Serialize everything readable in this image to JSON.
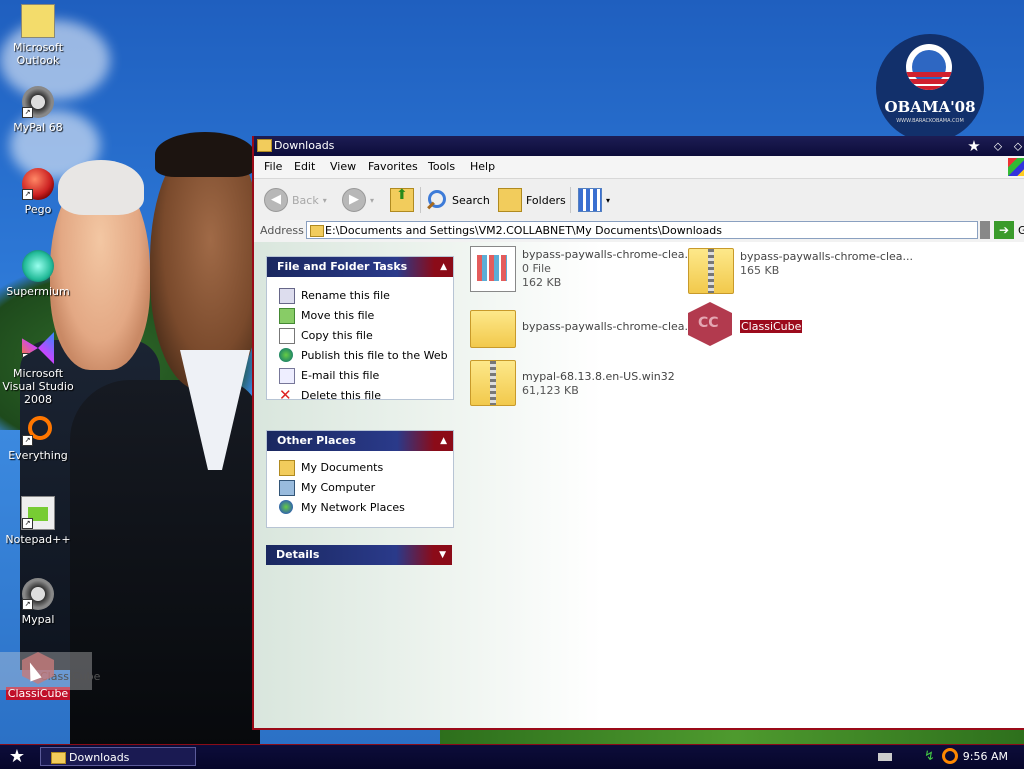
{
  "wallpaper": {
    "logo_text": "OBAMA'08",
    "logo_sub": "WWW.BARACKOBAMA.COM"
  },
  "desktop_icons": [
    {
      "label": "Microsoft Outlook",
      "icon": "outlook-icon"
    },
    {
      "label": "MyPal 68",
      "icon": "raccoon-icon"
    },
    {
      "label": "Pego",
      "icon": "pego-icon"
    },
    {
      "label": "Supermium",
      "icon": "supermium-icon"
    },
    {
      "label": "Microsoft Visual Studio 2008",
      "icon": "visual-studio-icon"
    },
    {
      "label": "Everything",
      "icon": "everything-icon"
    },
    {
      "label": "Notepad++",
      "icon": "notepadpp-icon"
    },
    {
      "label": "Mypal",
      "icon": "raccoon-icon"
    },
    {
      "label": "ClassiCube",
      "icon": "classicube-icon",
      "ghost_label": "ClassiCube"
    }
  ],
  "window": {
    "title": "Downloads",
    "menu": [
      "File",
      "Edit",
      "View",
      "Favorites",
      "Tools",
      "Help"
    ],
    "toolbar": {
      "back": "Back",
      "search": "Search",
      "folders": "Folders"
    },
    "address": {
      "label": "Address",
      "path": "E:\\Documents and Settings\\VM2.COLLABNET\\My Documents\\Downloads",
      "go": "Go"
    },
    "tasks_panel": {
      "title": "File and Folder Tasks",
      "items": [
        "Rename this file",
        "Move this file",
        "Copy this file",
        "Publish this file to the Web",
        "E-mail this file",
        "Delete this file"
      ]
    },
    "other_places": {
      "title": "Other Places",
      "items": [
        "My Documents",
        "My Computer",
        "My Network Places"
      ]
    },
    "details": {
      "title": "Details"
    },
    "files": [
      {
        "name": "bypass-paywalls-chrome-clea...",
        "line2": "0 File",
        "line3": "162 KB",
        "type": "exe"
      },
      {
        "name": "bypass-paywalls-chrome-clea...",
        "line2": "165 KB",
        "type": "zip"
      },
      {
        "name": "bypass-paywalls-chrome-clea...",
        "type": "folder"
      },
      {
        "name": "ClassiCube",
        "type": "cube",
        "selected": true
      },
      {
        "name": "mypal-68.13.8.en-US.win32",
        "line2": "61,123 KB",
        "type": "zip"
      }
    ]
  },
  "taskbar": {
    "task": "Downloads",
    "clock": "9:56 AM"
  }
}
